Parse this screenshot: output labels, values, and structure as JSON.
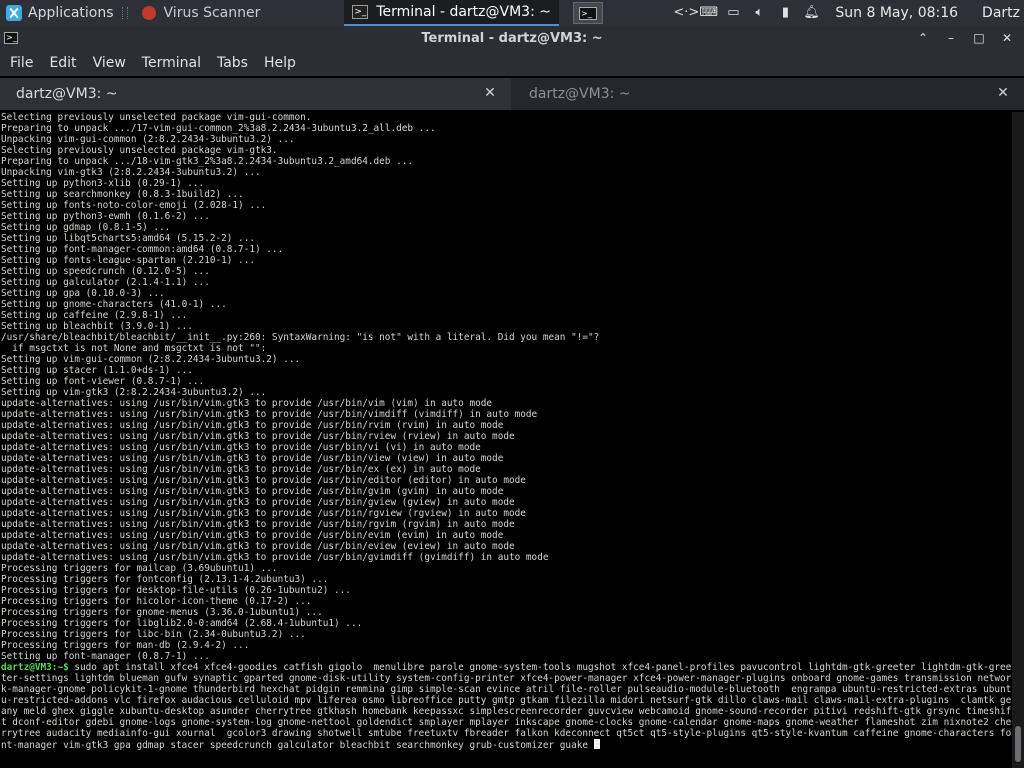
{
  "panel": {
    "applications_label": "Applications",
    "tasks": [
      {
        "label": "Virus Scanner",
        "active": false
      },
      {
        "label": "Terminal - dartz@VM3: ~",
        "active": true
      }
    ],
    "launcher_glyph": ">_",
    "tray_icons": [
      "dev-code-icon",
      "keyboard-icon",
      "display-icon",
      "volume-icon",
      "battery-icon",
      "notification-bell-icon"
    ],
    "clock": "Sun  8 May, 08:16",
    "user": "Dartz"
  },
  "window": {
    "title": "Terminal - dartz@VM3: ~"
  },
  "menu": [
    "File",
    "Edit",
    "View",
    "Terminal",
    "Tabs",
    "Help"
  ],
  "tabs": [
    {
      "label": "dartz@VM3: ~",
      "active": true
    },
    {
      "label": "dartz@VM3: ~",
      "active": false
    }
  ],
  "terminal": {
    "lines": [
      "Selecting previously unselected package vim-gui-common.",
      "Preparing to unpack .../17-vim-gui-common_2%3a8.2.2434-3ubuntu3.2_all.deb ...",
      "Unpacking vim-gui-common (2:8.2.2434-3ubuntu3.2) ...",
      "Selecting previously unselected package vim-gtk3.",
      "Preparing to unpack .../18-vim-gtk3_2%3a8.2.2434-3ubuntu3.2_amd64.deb ...",
      "Unpacking vim-gtk3 (2:8.2.2434-3ubuntu3.2) ...",
      "Setting up python3-xlib (0.29-1) ...",
      "Setting up searchmonkey (0.8.3-1build2) ...",
      "Setting up fonts-noto-color-emoji (2.028-1) ...",
      "Setting up python3-ewmh (0.1.6-2) ...",
      "Setting up gdmap (0.8.1-5) ...",
      "Setting up libqt5charts5:amd64 (5.15.2-2) ...",
      "Setting up font-manager-common:amd64 (0.8.7-1) ...",
      "Setting up fonts-league-spartan (2.210-1) ...",
      "Setting up speedcrunch (0.12.0-5) ...",
      "Setting up galculator (2.1.4-1.1) ...",
      "Setting up gpa (0.10.0-3) ...",
      "Setting up gnome-characters (41.0-1) ...",
      "Setting up caffeine (2.9.8-1) ...",
      "Setting up bleachbit (3.9.0-1) ...",
      "/usr/share/bleachbit/bleachbit/__init__.py:260: SyntaxWarning: \"is not\" with a literal. Did you mean \"!=\"?",
      "  if msgctxt is not None and msgctxt is not \"\":",
      "Setting up vim-gui-common (2:8.2.2434-3ubuntu3.2) ...",
      "Setting up stacer (1.1.0+ds-1) ...",
      "Setting up font-viewer (0.8.7-1) ...",
      "Setting up vim-gtk3 (2:8.2.2434-3ubuntu3.2) ...",
      "update-alternatives: using /usr/bin/vim.gtk3 to provide /usr/bin/vim (vim) in auto mode",
      "update-alternatives: using /usr/bin/vim.gtk3 to provide /usr/bin/vimdiff (vimdiff) in auto mode",
      "update-alternatives: using /usr/bin/vim.gtk3 to provide /usr/bin/rvim (rvim) in auto mode",
      "update-alternatives: using /usr/bin/vim.gtk3 to provide /usr/bin/rview (rview) in auto mode",
      "update-alternatives: using /usr/bin/vim.gtk3 to provide /usr/bin/vi (vi) in auto mode",
      "update-alternatives: using /usr/bin/vim.gtk3 to provide /usr/bin/view (view) in auto mode",
      "update-alternatives: using /usr/bin/vim.gtk3 to provide /usr/bin/ex (ex) in auto mode",
      "update-alternatives: using /usr/bin/vim.gtk3 to provide /usr/bin/editor (editor) in auto mode",
      "update-alternatives: using /usr/bin/vim.gtk3 to provide /usr/bin/gvim (gvim) in auto mode",
      "update-alternatives: using /usr/bin/vim.gtk3 to provide /usr/bin/gview (gview) in auto mode",
      "update-alternatives: using /usr/bin/vim.gtk3 to provide /usr/bin/rgview (rgview) in auto mode",
      "update-alternatives: using /usr/bin/vim.gtk3 to provide /usr/bin/rgvim (rgvim) in auto mode",
      "update-alternatives: using /usr/bin/vim.gtk3 to provide /usr/bin/evim (evim) in auto mode",
      "update-alternatives: using /usr/bin/vim.gtk3 to provide /usr/bin/eview (eview) in auto mode",
      "update-alternatives: using /usr/bin/vim.gtk3 to provide /usr/bin/gvimdiff (gvimdiff) in auto mode",
      "Processing triggers for mailcap (3.69ubuntu1) ...",
      "Processing triggers for fontconfig (2.13.1-4.2ubuntu3) ...",
      "Processing triggers for desktop-file-utils (0.26-1ubuntu2) ...",
      "Processing triggers for hicolor-icon-theme (0.17-2) ...",
      "Processing triggers for gnome-menus (3.36.0-1ubuntu1) ...",
      "Processing triggers for libglib2.0-0:amd64 (2.68.4-1ubuntu1) ...",
      "Processing triggers for libc-bin (2.34-0ubuntu3.2) ...",
      "Processing triggers for man-db (2.9.4-2) ...",
      "Setting up font-manager (0.8.7-1) ..."
    ],
    "prompt": "dartz@VM3:~$",
    "command": " sudo apt install xfce4 xfce4-goodies catfish gigolo  menulibre parole gnome-system-tools mugshot xfce4-panel-profiles pavucontrol lightdm-gtk-greeter lightdm-gtk-greeter-settings lightdm blueman gufw synaptic gparted gnome-disk-utility system-config-printer xfce4-power-manager xfce4-power-manager-plugins onboard gnome-games transmission network-manager-gnome policykit-1-gnome thunderbird hexchat pidgin remmina gimp simple-scan evince atril file-roller pulseaudio-module-bluetooth  engrampa ubuntu-restricted-extras ubuntu-restricted-addons vlc firefox audacious celluloid mpv liferea osmo libreoffice putty gmtp gtkam filezilla midori netsurf-gtk dillo claws-mail claws-mail-extra-plugins  clamtk geany meld ghex giggle xubuntu-desktop asunder cherrytree gtkhash homebank keepassxc simplescreenrecorder guvcview webcamoid gnome-sound-recorder pitivi redshift-gtk grsync timeshift dconf-editor gdebi gnome-logs gnome-system-log gnome-nettool goldendict smplayer mplayer inkscape gnome-clocks gnome-calendar gnome-maps gnome-weather flameshot zim nixnote2 cherrytree audacity mediainfo-gui xournal  gcolor3 drawing shotwell smtube freetuxtv fbreader falkon kdeconnect qt5ct qt5-style-plugins qt5-style-kvantum caffeine gnome-characters font-manager vim-gtk3 gpa gdmap stacer speedcrunch galculator bleachbit searchmonkey grub-customizer guake "
  }
}
